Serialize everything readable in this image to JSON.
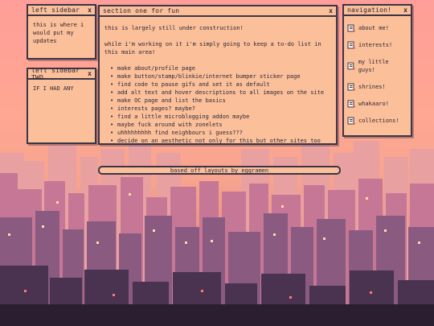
{
  "windows": {
    "left1": {
      "title": "left sidebar",
      "close": "x",
      "text": "this is where i would put my updates"
    },
    "left2": {
      "title": "left sidebar TWO",
      "close": "x",
      "text": "IF I HAD ANY"
    },
    "main": {
      "title": "section one for fun",
      "close": "x",
      "intro": "this is largely still under construction!",
      "lead": "while i'm working on it i'm simply going to keep a to-do list in this main area!",
      "todo": [
        "make about/profile page",
        "make button/stamp/blinkie/internet bumper sticker page",
        "find code to pause gifs and set it as default",
        "add alt text and hover descriptions to all images on the site",
        "make OC page and list the basics",
        "interests pages? maybe?",
        "find a little microblogging addon maybe",
        "maybe fuck around with zonelets",
        "uhhhhhhhhh find neighbours i guess???",
        "decide on an aesthetic not only for this but other sites too"
      ]
    },
    "nav": {
      "title": "navigation!",
      "close": "x",
      "items": [
        {
          "label": "about me!",
          "icon": "scroll-icon"
        },
        {
          "label": "interests!",
          "icon": "scroll-icon"
        },
        {
          "label": "my little guys!",
          "icon": "scroll-icon"
        },
        {
          "label": "shrines!",
          "icon": "scroll-icon"
        },
        {
          "label": "whakaaro!",
          "icon": "scroll-icon"
        },
        {
          "label": "collections!",
          "icon": "scroll-icon"
        }
      ]
    }
  },
  "footer": {
    "text": "based off layouts by eggramen"
  },
  "colors": {
    "window_bg": "#fbbf9a",
    "border": "#3b3646",
    "text": "#2c2834"
  }
}
